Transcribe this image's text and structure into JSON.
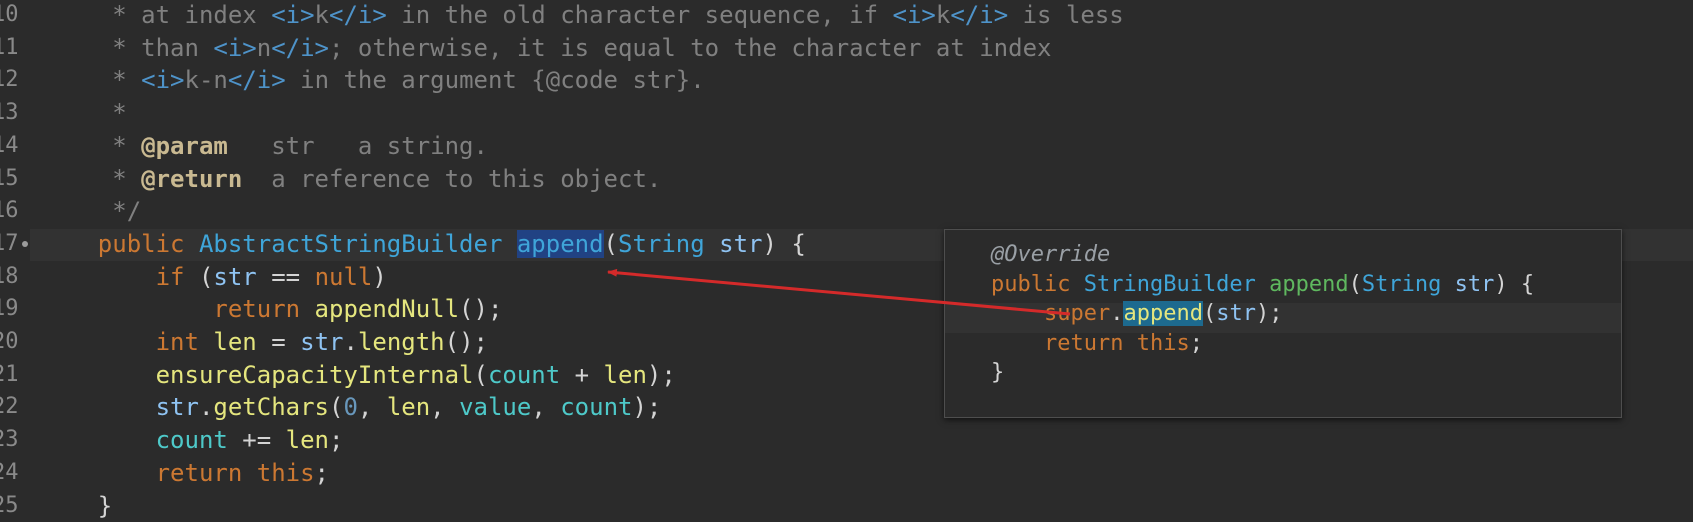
{
  "gutter": {
    "line_numbers": [
      "10",
      "11",
      "12",
      "13",
      "14",
      "15",
      "16",
      "17",
      "18",
      "19",
      "20",
      "21",
      "22",
      "23",
      "24",
      "25"
    ]
  },
  "editor": {
    "lines": [
      {
        "segments": [
          {
            "t": "     * at index ",
            "c": "c"
          },
          {
            "t": "<i>",
            "c": "tag"
          },
          {
            "t": "k",
            "c": "c"
          },
          {
            "t": "</i>",
            "c": "tag"
          },
          {
            "t": " in the old character sequence, if ",
            "c": "c"
          },
          {
            "t": "<i>",
            "c": "tag"
          },
          {
            "t": "k",
            "c": "c"
          },
          {
            "t": "</i>",
            "c": "tag"
          },
          {
            "t": " is less",
            "c": "c"
          }
        ]
      },
      {
        "segments": [
          {
            "t": "     * than ",
            "c": "c"
          },
          {
            "t": "<i>",
            "c": "tag"
          },
          {
            "t": "n",
            "c": "c"
          },
          {
            "t": "</i>",
            "c": "tag"
          },
          {
            "t": "; otherwise, it is equal to the character at index",
            "c": "c"
          }
        ]
      },
      {
        "segments": [
          {
            "t": "     * ",
            "c": "c"
          },
          {
            "t": "<i>",
            "c": "tag"
          },
          {
            "t": "k-n",
            "c": "c"
          },
          {
            "t": "</i>",
            "c": "tag"
          },
          {
            "t": " in the argument {@code str}.",
            "c": "c"
          }
        ]
      },
      {
        "segments": [
          {
            "t": "     *",
            "c": "c"
          }
        ]
      },
      {
        "segments": [
          {
            "t": "     * ",
            "c": "c"
          },
          {
            "t": "@param",
            "c": "doctag"
          },
          {
            "t": "   str   a string.",
            "c": "c"
          }
        ]
      },
      {
        "segments": [
          {
            "t": "     * ",
            "c": "c"
          },
          {
            "t": "@return",
            "c": "doctag"
          },
          {
            "t": "  a reference to this object.",
            "c": "c"
          }
        ]
      },
      {
        "segments": [
          {
            "t": "     */",
            "c": "c"
          }
        ]
      },
      {
        "segments": [
          {
            "t": "    ",
            "c": ""
          },
          {
            "t": "public",
            "c": "kw"
          },
          {
            "t": " ",
            "c": ""
          },
          {
            "t": "AbstractStringBuilder",
            "c": "type"
          },
          {
            "t": " ",
            "c": ""
          },
          {
            "t": "append",
            "c": "type sel"
          },
          {
            "t": "(",
            "c": "paren"
          },
          {
            "t": "String",
            "c": "type"
          },
          {
            "t": " ",
            "c": ""
          },
          {
            "t": "str",
            "c": "var"
          },
          {
            "t": ") {",
            "c": "paren"
          }
        ]
      },
      {
        "segments": [
          {
            "t": "        ",
            "c": ""
          },
          {
            "t": "if",
            "c": "kw"
          },
          {
            "t": " (",
            "c": "paren"
          },
          {
            "t": "str",
            "c": "var"
          },
          {
            "t": " == ",
            "c": "paren"
          },
          {
            "t": "null",
            "c": "kw"
          },
          {
            "t": ")",
            "c": "paren"
          }
        ]
      },
      {
        "segments": [
          {
            "t": "            ",
            "c": ""
          },
          {
            "t": "return",
            "c": "kw"
          },
          {
            "t": " ",
            "c": ""
          },
          {
            "t": "appendNull",
            "c": "fn"
          },
          {
            "t": "();",
            "c": "paren"
          }
        ]
      },
      {
        "segments": [
          {
            "t": "        ",
            "c": ""
          },
          {
            "t": "int",
            "c": "kw"
          },
          {
            "t": " ",
            "c": ""
          },
          {
            "t": "len",
            "c": "fn"
          },
          {
            "t": " = ",
            "c": "paren"
          },
          {
            "t": "str",
            "c": "var"
          },
          {
            "t": ".",
            "c": "paren"
          },
          {
            "t": "length",
            "c": "fn"
          },
          {
            "t": "();",
            "c": "paren"
          }
        ]
      },
      {
        "segments": [
          {
            "t": "        ",
            "c": ""
          },
          {
            "t": "ensureCapacityInternal",
            "c": "fn"
          },
          {
            "t": "(",
            "c": "paren"
          },
          {
            "t": "count",
            "c": "fld"
          },
          {
            "t": " + ",
            "c": "paren"
          },
          {
            "t": "len",
            "c": "fn"
          },
          {
            "t": ");",
            "c": "paren"
          }
        ]
      },
      {
        "segments": [
          {
            "t": "        ",
            "c": ""
          },
          {
            "t": "str",
            "c": "var"
          },
          {
            "t": ".",
            "c": "paren"
          },
          {
            "t": "getChars",
            "c": "fn"
          },
          {
            "t": "(",
            "c": "paren"
          },
          {
            "t": "0",
            "c": "num"
          },
          {
            "t": ", ",
            "c": "paren"
          },
          {
            "t": "len",
            "c": "fn"
          },
          {
            "t": ", ",
            "c": "paren"
          },
          {
            "t": "value",
            "c": "fld"
          },
          {
            "t": ", ",
            "c": "paren"
          },
          {
            "t": "count",
            "c": "fld"
          },
          {
            "t": ");",
            "c": "paren"
          }
        ]
      },
      {
        "segments": [
          {
            "t": "        ",
            "c": ""
          },
          {
            "t": "count",
            "c": "fld"
          },
          {
            "t": " += ",
            "c": "paren"
          },
          {
            "t": "len",
            "c": "fn"
          },
          {
            "t": ";",
            "c": "paren"
          }
        ]
      },
      {
        "segments": [
          {
            "t": "        ",
            "c": ""
          },
          {
            "t": "return",
            "c": "kw"
          },
          {
            "t": " ",
            "c": ""
          },
          {
            "t": "this",
            "c": "kw"
          },
          {
            "t": ";",
            "c": "paren"
          }
        ]
      },
      {
        "segments": [
          {
            "t": "    }",
            "c": "paren"
          }
        ]
      }
    ]
  },
  "popup": {
    "lines": [
      {
        "segments": [
          {
            "t": "@Override",
            "c": "ann"
          }
        ]
      },
      {
        "segments": [
          {
            "t": "public",
            "c": "kw"
          },
          {
            "t": " ",
            "c": ""
          },
          {
            "t": "StringBuilder",
            "c": "type"
          },
          {
            "t": " ",
            "c": ""
          },
          {
            "t": "append",
            "c": "fn2"
          },
          {
            "t": "(",
            "c": "paren"
          },
          {
            "t": "String",
            "c": "type"
          },
          {
            "t": " ",
            "c": ""
          },
          {
            "t": "str",
            "c": "var"
          },
          {
            "t": ") {",
            "c": "paren"
          }
        ]
      },
      {
        "segments": [
          {
            "t": "    ",
            "c": ""
          },
          {
            "t": "super",
            "c": "kw"
          },
          {
            "t": ".",
            "c": "paren"
          },
          {
            "t": "append",
            "c": "fn hl"
          },
          {
            "t": "(",
            "c": "paren"
          },
          {
            "t": "str",
            "c": "var"
          },
          {
            "t": ");",
            "c": "paren"
          }
        ]
      },
      {
        "segments": [
          {
            "t": "    ",
            "c": ""
          },
          {
            "t": "return",
            "c": "kw"
          },
          {
            "t": " ",
            "c": ""
          },
          {
            "t": "this",
            "c": "kw"
          },
          {
            "t": ";",
            "c": "paren"
          }
        ]
      },
      {
        "segments": [
          {
            "t": "}",
            "c": "paren"
          }
        ]
      }
    ]
  },
  "annotation": {
    "arrow_color": "#d42a2a"
  }
}
